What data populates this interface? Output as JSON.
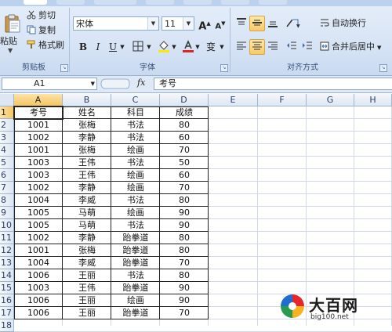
{
  "ribbon": {
    "clipboard": {
      "paste_label": "粘贴",
      "cut_label": "剪切",
      "copy_label": "复制",
      "format_painter_label": "格式刷",
      "group_label": "剪贴板"
    },
    "font": {
      "font_name": "宋体",
      "font_size": "11",
      "bold": "B",
      "italic": "I",
      "underline": "U",
      "grow": "A",
      "shrink": "A",
      "wen": "变",
      "group_label": "字体"
    },
    "alignment": {
      "wrap_text_label": "自动换行",
      "merge_center_label": "合并后居中",
      "group_label": "对齐方式"
    }
  },
  "formula_bar": {
    "name_box": "A1",
    "fx": "fx",
    "formula": "考号"
  },
  "columns": [
    "A",
    "B",
    "C",
    "D",
    "E",
    "F",
    "G",
    "H"
  ],
  "rows": [
    "1",
    "2",
    "3",
    "4",
    "5",
    "6",
    "7",
    "8",
    "9",
    "10",
    "11",
    "12",
    "13",
    "14",
    "15",
    "16",
    "17",
    "18"
  ],
  "table": {
    "headers": [
      "考号",
      "姓名",
      "科目",
      "成绩"
    ],
    "rows": [
      [
        "1001",
        "张梅",
        "书法",
        "80"
      ],
      [
        "1002",
        "李静",
        "书法",
        "60"
      ],
      [
        "1001",
        "张梅",
        "绘画",
        "70"
      ],
      [
        "1003",
        "王伟",
        "书法",
        "50"
      ],
      [
        "1003",
        "王伟",
        "绘画",
        "60"
      ],
      [
        "1002",
        "李静",
        "绘画",
        "70"
      ],
      [
        "1004",
        "李威",
        "书法",
        "80"
      ],
      [
        "1005",
        "马萌",
        "绘画",
        "90"
      ],
      [
        "1005",
        "马萌",
        "书法",
        "90"
      ],
      [
        "1002",
        "李静",
        "跆拳道",
        "80"
      ],
      [
        "1001",
        "张梅",
        "跆拳道",
        "80"
      ],
      [
        "1004",
        "李威",
        "跆拳道",
        "70"
      ],
      [
        "1006",
        "王丽",
        "书法",
        "80"
      ],
      [
        "1003",
        "王伟",
        "跆拳道",
        "90"
      ],
      [
        "1006",
        "王丽",
        "绘画",
        "90"
      ],
      [
        "1006",
        "王丽",
        "跆拳道",
        "70"
      ]
    ]
  },
  "watermark": {
    "name": "大百网",
    "url": "big100.net"
  },
  "colors": {
    "ribbon_bg": "#d7e4f5",
    "header_active": "#f5c563",
    "selection_highlight": "#f7c96b"
  }
}
